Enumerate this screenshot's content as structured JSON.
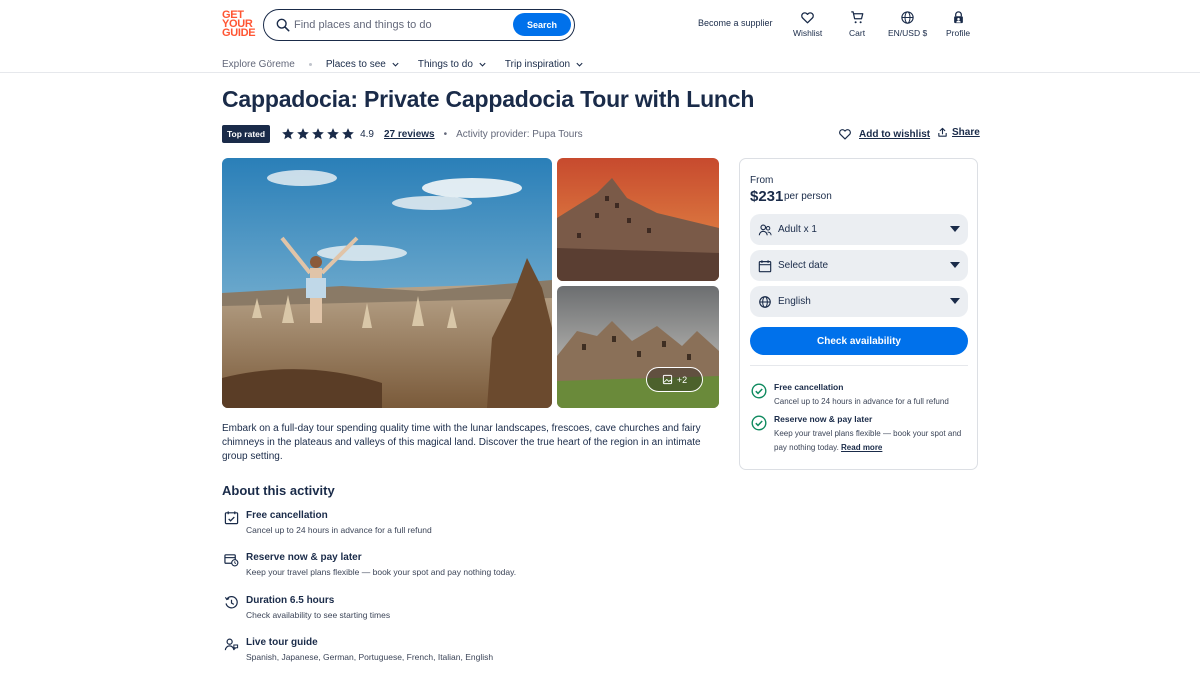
{
  "logo": [
    "GET",
    "YOUR",
    "GUIDE"
  ],
  "search": {
    "placeholder": "Find places and things to do",
    "button": "Search"
  },
  "header": {
    "supplier": "Become a supplier",
    "wishlist": "Wishlist",
    "cart": "Cart",
    "currency": "EN/USD $",
    "profile": "Profile"
  },
  "subnav": {
    "explore": "Explore Göreme",
    "places": "Places to see",
    "things": "Things to do",
    "trip": "Trip inspiration"
  },
  "title": "Cappadocia: Private Cappadocia Tour with Lunch",
  "meta": {
    "badge": "Top rated",
    "rating": "4.9",
    "stars": 5,
    "reviews": "27 reviews",
    "sep": "•",
    "provider": "Activity provider: Pupa Tours",
    "add_wishlist": "Add to wishlist",
    "share": "Share"
  },
  "gallery": {
    "more": "+2"
  },
  "description": "Embark on a full-day tour spending quality time with the lunar landscapes, frescoes, cave churches and fairy chimneys in the plateaus and valleys of this magical land. Discover the true heart of the region in an intimate group setting.",
  "about": {
    "title": "About this activity",
    "items": [
      {
        "title": "Free cancellation",
        "sub": "Cancel up to 24 hours in advance for a full refund",
        "icon": "calendar-check-icon"
      },
      {
        "title": "Reserve now & pay later",
        "sub": "Keep your travel plans flexible — book your spot and pay nothing today.",
        "icon": "wallet-clock-icon"
      },
      {
        "title": "Duration 6.5 hours",
        "sub": "Check availability to see starting times",
        "icon": "clock-history-icon"
      },
      {
        "title": "Live tour guide",
        "sub": "Spanish, Japanese, German, Portuguese, French, Italian, English",
        "icon": "guide-icon"
      }
    ]
  },
  "booking": {
    "from": "From",
    "price": "$231",
    "per": "per person",
    "participants": "Adult x 1",
    "date": "Select date",
    "language": "English",
    "check": "Check availability",
    "free_cancel_title": "Free cancellation",
    "free_cancel_sub": "Cancel up to 24 hours in advance for a full refund",
    "reserve_title": "Reserve now & pay later",
    "reserve_sub": "Keep your travel plans flexible — book your spot and pay nothing today.",
    "read_more": "Read more"
  },
  "colors": {
    "brand": "#ff5533",
    "primary": "#0071eb",
    "text": "#1a2b49",
    "success": "#0f8a5f"
  }
}
